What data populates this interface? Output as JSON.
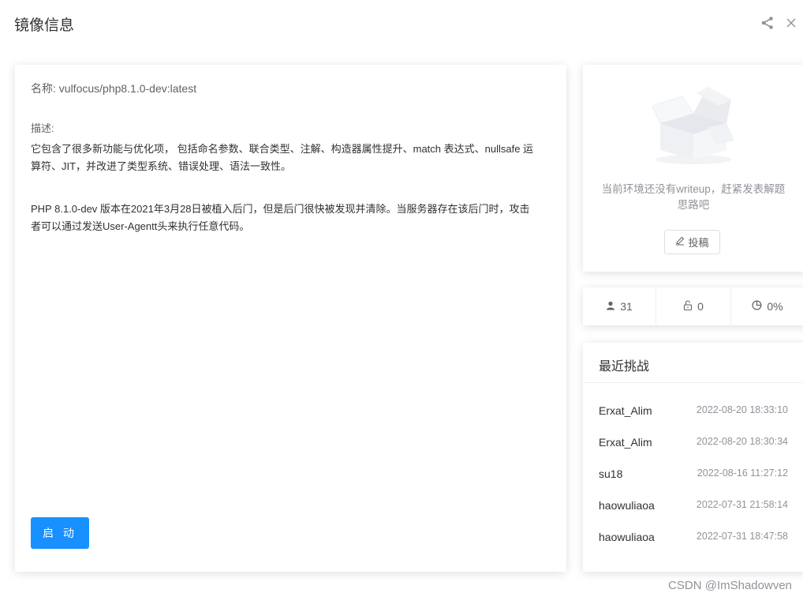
{
  "dialog": {
    "title": "镜像信息",
    "share_icon": "share-icon",
    "close_icon": "close-icon"
  },
  "image": {
    "name_line": "名称: vulfocus/php8.1.0-dev:latest",
    "desc_label": "描述:",
    "desc_p1": "它包含了很多新功能与优化项， 包括命名参数、联合类型、注解、构造器属性提升、match 表达式、nullsafe 运算符、JIT，并改进了类型系统、错误处理、语法一致性。",
    "desc_p2": "PHP 8.1.0-dev 版本在2021年3月28日被植入后门，但是后门很快被发现并清除。当服务器存在该后门时，攻击者可以通过发送User-Agentt头来执行任意代码。",
    "start_label": "启 动"
  },
  "writeup": {
    "empty_text": "当前环境还没有writeup，赶紧发表解题思路吧",
    "submit_label": "投稿",
    "submit_icon": "edit-icon"
  },
  "stats": {
    "users": "31",
    "users_icon": "user-icon",
    "unlocks": "0",
    "unlocks_icon": "unlock-icon",
    "rate": "0%",
    "rate_icon": "pie-chart-icon"
  },
  "recent": {
    "title": "最近挑战",
    "items": [
      {
        "user": "Erxat_Alim",
        "time": "2022-08-20 18:33:10"
      },
      {
        "user": "Erxat_Alim",
        "time": "2022-08-20 18:30:34"
      },
      {
        "user": "su18",
        "time": "2022-08-16 11:27:12"
      },
      {
        "user": "haowuliaoa",
        "time": "2022-07-31 21:58:14"
      },
      {
        "user": "haowuliaoa",
        "time": "2022-07-31 18:47:58"
      }
    ]
  },
  "watermark": "CSDN @ImShadowven"
}
